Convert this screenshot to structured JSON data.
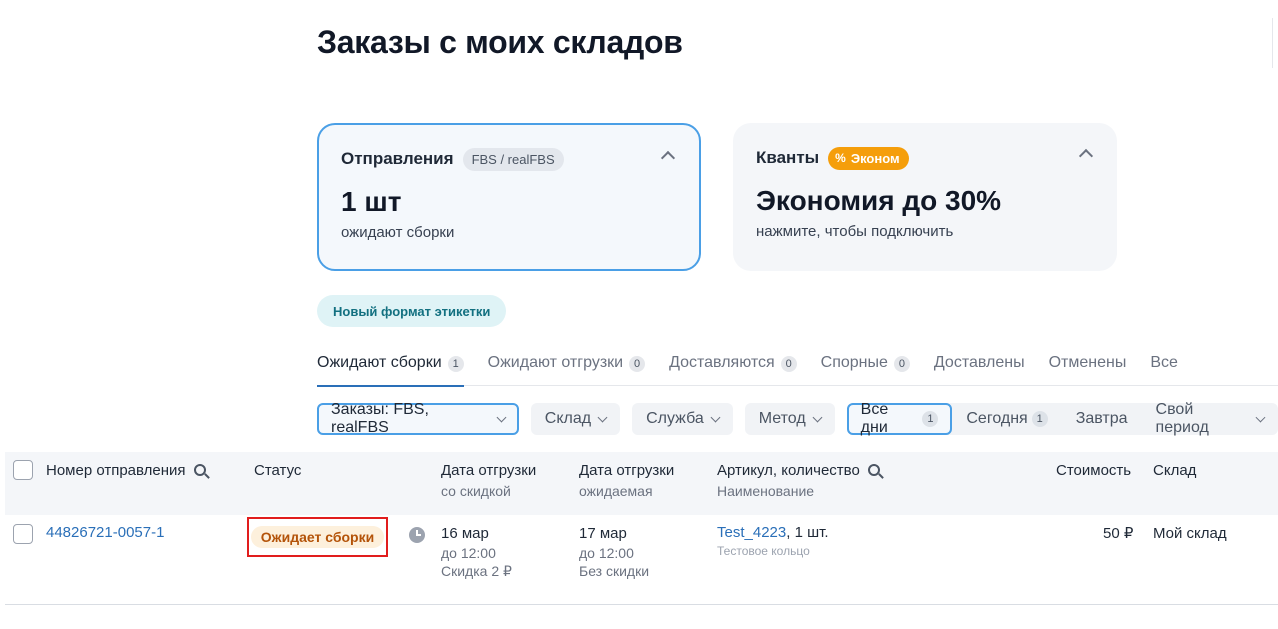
{
  "page_title": "Заказы с моих складов",
  "cards": [
    {
      "title": "Отправления",
      "chip": "FBS / realFBS",
      "big": "1 шт",
      "sub": "ожидают сборки"
    },
    {
      "title": "Кванты",
      "badge_icon": "%",
      "badge": "Эконом",
      "big": "Экономия до 30%",
      "sub": "нажмите, чтобы подключить"
    }
  ],
  "label_format_button": "Новый формат этикетки",
  "tabs": [
    {
      "label": "Ожидают сборки",
      "count": "1"
    },
    {
      "label": "Ожидают отгрузки",
      "count": "0"
    },
    {
      "label": "Доставляются",
      "count": "0"
    },
    {
      "label": "Спорные",
      "count": "0"
    },
    {
      "label": "Доставлены",
      "count": ""
    },
    {
      "label": "Отменены",
      "count": ""
    },
    {
      "label": "Все",
      "count": ""
    }
  ],
  "filters": {
    "orders": "Заказы: FBS, realFBS",
    "warehouse": "Склад",
    "service": "Служба",
    "method": "Метод",
    "period_all": "Все дни",
    "period_all_count": "1",
    "period_today": "Сегодня",
    "period_today_count": "1",
    "period_tomorrow": "Завтра",
    "period_custom": "Свой период"
  },
  "table": {
    "headers": {
      "number": "Номер отправления",
      "status": "Статус",
      "ship_date": "Дата отгрузки",
      "ship_date_sub": "со скидкой",
      "ship_date_expected": "Дата отгрузки",
      "ship_date_expected_sub": "ожидаемая",
      "article": "Артикул, количество",
      "article_sub": "Наименование",
      "cost": "Стоимость",
      "warehouse": "Склад"
    },
    "rows": [
      {
        "number": "44826721-0057-1",
        "status": "Ожидает сборки",
        "ship_date": "16 мар",
        "ship_time": "до 12:00",
        "ship_discount": "Скидка 2 ₽",
        "exp_date": "17 мар",
        "exp_time": "до 12:00",
        "exp_discount": "Без скидки",
        "article": "Test_4223",
        "quantity": ", 1 шт.",
        "name": "Тестовое кольцо",
        "cost": "50 ₽",
        "warehouse": "Мой склад"
      }
    ]
  },
  "colors": {
    "accent_border": "#4a9fe6",
    "link": "#2a6fb8",
    "badge_orange": "#f59e0b",
    "status_highlight": "#e11d1d"
  }
}
